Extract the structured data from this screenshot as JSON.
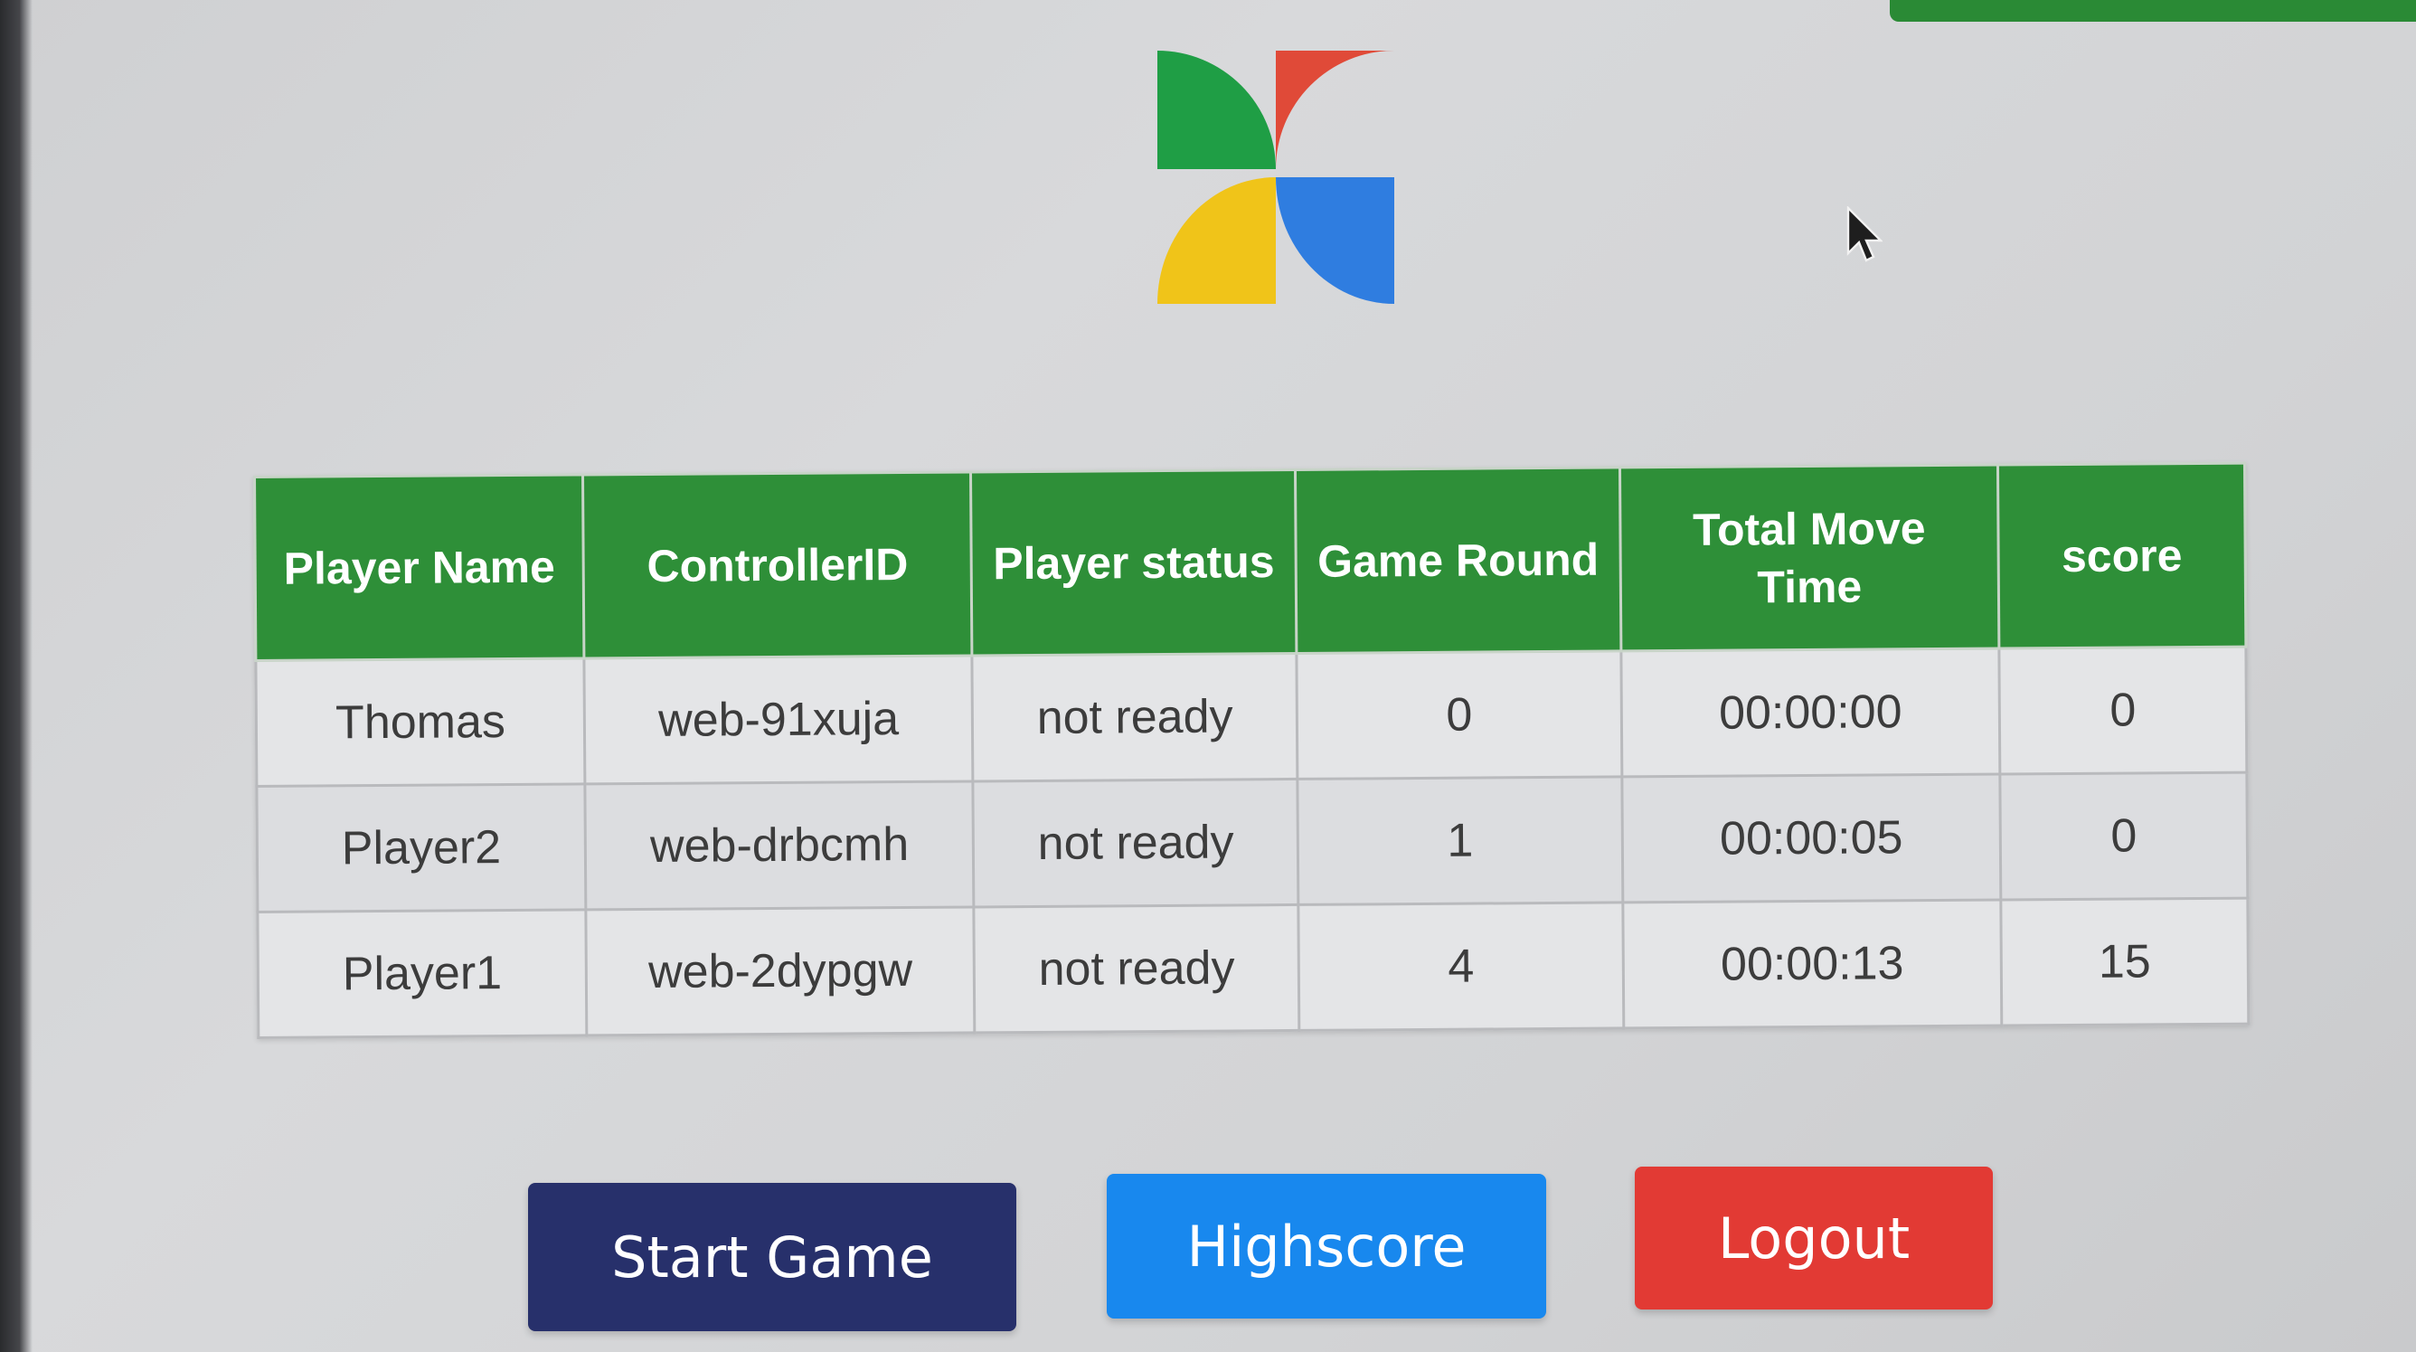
{
  "table": {
    "headers": [
      "Player Name",
      "ControllerID",
      "Player status",
      "Game Round",
      "Total Move Time",
      "score"
    ],
    "rows": [
      [
        "Thomas",
        "web-91xuja",
        "not ready",
        "0",
        "00:00:00",
        "0"
      ],
      [
        "Player2",
        "web-drbcmh",
        "not ready",
        "1",
        "00:00:05",
        "0"
      ],
      [
        "Player1",
        "web-2dypgw",
        "not ready",
        "4",
        "00:00:13",
        "15"
      ]
    ]
  },
  "buttons": {
    "start": "Start Game",
    "highscore": "Highscore",
    "logout": "Logout"
  },
  "colors": {
    "header_green": "#2e8f38",
    "start_navy": "#27306b",
    "highscore_blue": "#1888ee",
    "logout_red": "#e23a34",
    "logo_green": "#1f9e45",
    "logo_red": "#e04a38",
    "logo_blue": "#2f7de0",
    "logo_yellow": "#f0c419"
  },
  "icons": [
    "pinwheel-logo-icon",
    "mouse-pointer-icon"
  ]
}
